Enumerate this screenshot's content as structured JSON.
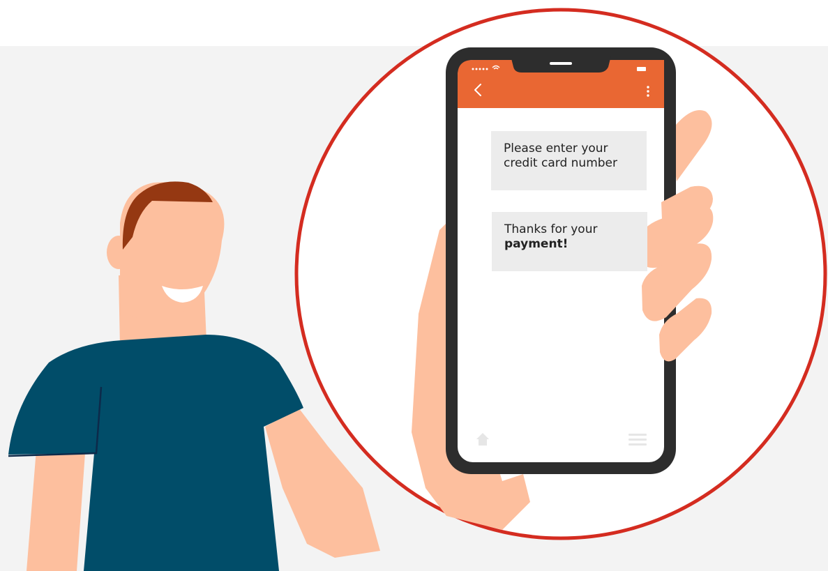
{
  "colors": {
    "page_background": "#ffffff",
    "backdrop": "#f3f3f3",
    "lens_fill": "#ffffff",
    "lens_ring": "#d42c20",
    "skin": "#fdbf9e",
    "hair": "#953812",
    "shirt": "#014d69",
    "phone_frame": "#2d2d2d",
    "app_header": "#e96733",
    "screen": "#ffffff",
    "bubble": "#ececec",
    "nav_icons": "#e6e6e6"
  },
  "icons": {
    "signal": "signal-dots-icon",
    "wifi": "wifi-icon",
    "battery": "battery-icon",
    "back": "chevron-left-icon",
    "more": "more-vertical-icon",
    "home": "home-icon",
    "menu": "hamburger-menu-icon"
  },
  "chat": {
    "messages": [
      {
        "line1": "Please enter your",
        "line2": "credit card number"
      },
      {
        "line1": "Thanks for your",
        "line2_bold": "payment!"
      }
    ]
  }
}
